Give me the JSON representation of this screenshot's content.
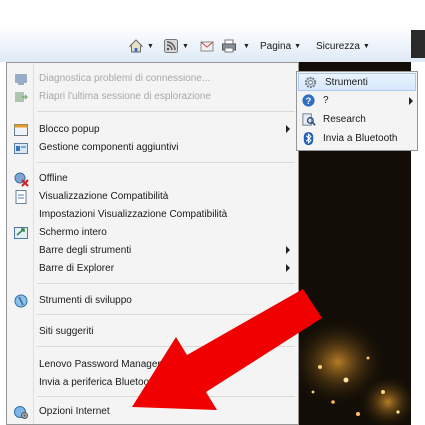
{
  "toolbar": {
    "home_icon": "home-icon",
    "feeds_icon": "rss-feeds-icon",
    "mail_icon": "mail-icon",
    "print_icon": "print-icon",
    "page_label": "Pagina",
    "security_label": "Sicurezza"
  },
  "menu": {
    "items": [
      {
        "label": "Diagnostica problemi di connessione...",
        "icon": "network-diagnostics-icon",
        "disabled": true
      },
      {
        "label": "Riapri l'ultima sessione di esplorazione",
        "icon": "reopen-session-icon",
        "disabled": true
      },
      {
        "label": "Blocco popup",
        "icon": "popup-blocker-icon",
        "submenu": true
      },
      {
        "label": "Gestione componenti aggiuntivi",
        "icon": "addons-icon"
      },
      {
        "label": "Offline",
        "icon": "offline-icon"
      },
      {
        "label": "Visualizzazione Compatibilità",
        "icon": "compatibility-view-icon"
      },
      {
        "label": "Impostazioni Visualizzazione Compatibilità"
      },
      {
        "label": "Schermo intero",
        "icon": "fullscreen-icon"
      },
      {
        "label": "Barre degli strumenti",
        "submenu": true
      },
      {
        "label": "Barre di Explorer",
        "submenu": true
      },
      {
        "label": "Strumenti di sviluppo",
        "icon": "developer-tools-icon"
      },
      {
        "label": "Siti suggeriti"
      },
      {
        "label": "Lenovo Password Manager"
      },
      {
        "label": "Invia a periferica Bluetooth"
      },
      {
        "label": "Opzioni Internet",
        "icon": "internet-options-icon"
      }
    ]
  },
  "submenu": {
    "items": [
      {
        "label": "Strumenti",
        "icon": "tools-gear-icon",
        "highlighted": true
      },
      {
        "label": "?",
        "icon": "help-icon",
        "submenu": true
      },
      {
        "label": "Research",
        "icon": "research-icon"
      },
      {
        "label": "Invia a Bluetooth",
        "icon": "bluetooth-icon"
      }
    ]
  },
  "colors": {
    "menu_bg": "#f4f4f4",
    "highlight": "#d6e8fb",
    "arrow_annotation": "#f00000",
    "dark_background": "#120d06"
  },
  "annotation": {
    "type": "red-arrow",
    "points_to": "Opzioni Internet"
  }
}
